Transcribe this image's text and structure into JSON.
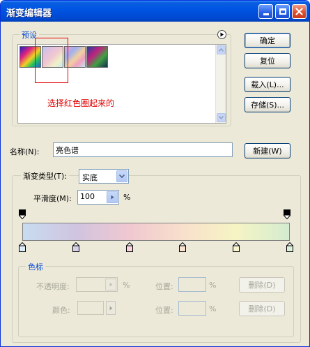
{
  "window": {
    "title": "渐变编辑器"
  },
  "presets": {
    "legend": "预设",
    "annotation": "选择红色圈起来的",
    "swatches": [
      {
        "name": "spectrum",
        "colors": [
          "#2020c0",
          "#e02080",
          "#f0d020",
          "#20a0e0"
        ]
      },
      {
        "name": "pastel-rainbow",
        "colors": [
          "#b8c8f0",
          "#f0c0d0",
          "#f0f0c0",
          "#c0e0f0"
        ]
      },
      {
        "name": "pastel-diagonal",
        "colors": [
          "#f0a0d0",
          "#a0b0f0",
          "#f0d0a0",
          "#c0e8f0"
        ]
      },
      {
        "name": "dark-spectrum",
        "colors": [
          "#2040a0",
          "#c02080",
          "#40a040",
          "#103050"
        ]
      }
    ]
  },
  "buttons": {
    "ok": "确定",
    "reset": "复位",
    "load": "载入(L)...",
    "save": "存储(S)...",
    "new": "新建(W)"
  },
  "name_field": {
    "label": "名称(N):",
    "value": "亮色谱"
  },
  "gradient": {
    "type_legend_label": "渐变类型(T):",
    "type_value": "实底",
    "smoothness_label": "平滑度(M):",
    "smoothness_value": "100",
    "smoothness_unit": "%",
    "bar_colors": [
      "#c8dcf0",
      "#d0c4e0",
      "#f0c8d0",
      "#f8e0cc",
      "#f6f4c4",
      "#d4ecd0"
    ],
    "color_stop_colors": [
      "#dcecf8",
      "#d8d0ea",
      "#f6d4dc",
      "#fae2d0",
      "#f8f4d0",
      "#ddf0dc"
    ]
  },
  "stops_group": {
    "legend": "色标",
    "opacity_label": "不透明度:",
    "percent1": "%",
    "position_label1": "位置:",
    "percent2": "%",
    "delete1": "删除(D)",
    "color_label": "颜色:",
    "position_label2": "位置:",
    "percent3": "%",
    "delete2": "删除(D)"
  }
}
